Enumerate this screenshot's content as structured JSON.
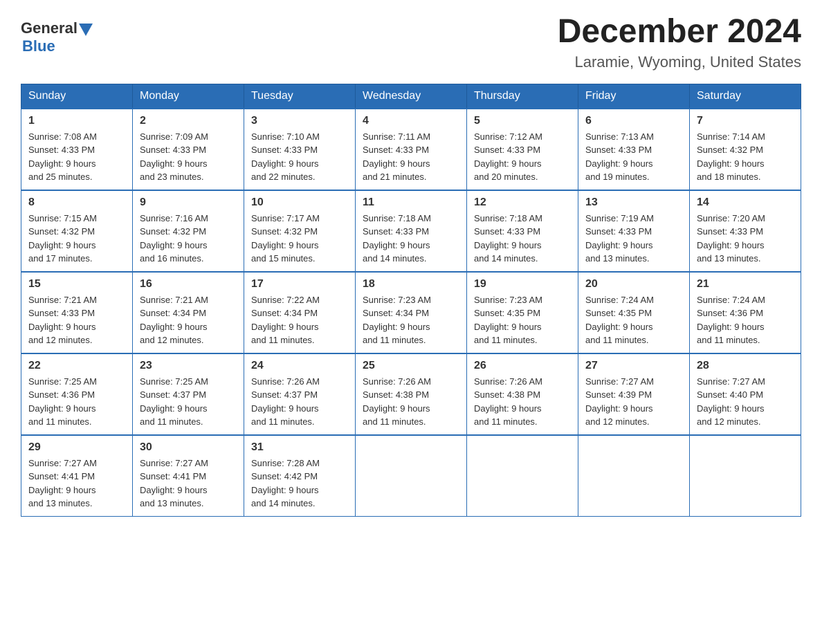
{
  "logo": {
    "general": "General",
    "blue": "Blue"
  },
  "header": {
    "month_year": "December 2024",
    "location": "Laramie, Wyoming, United States"
  },
  "weekdays": [
    "Sunday",
    "Monday",
    "Tuesday",
    "Wednesday",
    "Thursday",
    "Friday",
    "Saturday"
  ],
  "weeks": [
    [
      {
        "day": "1",
        "sunrise": "7:08 AM",
        "sunset": "4:33 PM",
        "daylight": "9 hours and 25 minutes."
      },
      {
        "day": "2",
        "sunrise": "7:09 AM",
        "sunset": "4:33 PM",
        "daylight": "9 hours and 23 minutes."
      },
      {
        "day": "3",
        "sunrise": "7:10 AM",
        "sunset": "4:33 PM",
        "daylight": "9 hours and 22 minutes."
      },
      {
        "day": "4",
        "sunrise": "7:11 AM",
        "sunset": "4:33 PM",
        "daylight": "9 hours and 21 minutes."
      },
      {
        "day": "5",
        "sunrise": "7:12 AM",
        "sunset": "4:33 PM",
        "daylight": "9 hours and 20 minutes."
      },
      {
        "day": "6",
        "sunrise": "7:13 AM",
        "sunset": "4:33 PM",
        "daylight": "9 hours and 19 minutes."
      },
      {
        "day": "7",
        "sunrise": "7:14 AM",
        "sunset": "4:32 PM",
        "daylight": "9 hours and 18 minutes."
      }
    ],
    [
      {
        "day": "8",
        "sunrise": "7:15 AM",
        "sunset": "4:32 PM",
        "daylight": "9 hours and 17 minutes."
      },
      {
        "day": "9",
        "sunrise": "7:16 AM",
        "sunset": "4:32 PM",
        "daylight": "9 hours and 16 minutes."
      },
      {
        "day": "10",
        "sunrise": "7:17 AM",
        "sunset": "4:32 PM",
        "daylight": "9 hours and 15 minutes."
      },
      {
        "day": "11",
        "sunrise": "7:18 AM",
        "sunset": "4:33 PM",
        "daylight": "9 hours and 14 minutes."
      },
      {
        "day": "12",
        "sunrise": "7:18 AM",
        "sunset": "4:33 PM",
        "daylight": "9 hours and 14 minutes."
      },
      {
        "day": "13",
        "sunrise": "7:19 AM",
        "sunset": "4:33 PM",
        "daylight": "9 hours and 13 minutes."
      },
      {
        "day": "14",
        "sunrise": "7:20 AM",
        "sunset": "4:33 PM",
        "daylight": "9 hours and 13 minutes."
      }
    ],
    [
      {
        "day": "15",
        "sunrise": "7:21 AM",
        "sunset": "4:33 PM",
        "daylight": "9 hours and 12 minutes."
      },
      {
        "day": "16",
        "sunrise": "7:21 AM",
        "sunset": "4:34 PM",
        "daylight": "9 hours and 12 minutes."
      },
      {
        "day": "17",
        "sunrise": "7:22 AM",
        "sunset": "4:34 PM",
        "daylight": "9 hours and 11 minutes."
      },
      {
        "day": "18",
        "sunrise": "7:23 AM",
        "sunset": "4:34 PM",
        "daylight": "9 hours and 11 minutes."
      },
      {
        "day": "19",
        "sunrise": "7:23 AM",
        "sunset": "4:35 PM",
        "daylight": "9 hours and 11 minutes."
      },
      {
        "day": "20",
        "sunrise": "7:24 AM",
        "sunset": "4:35 PM",
        "daylight": "9 hours and 11 minutes."
      },
      {
        "day": "21",
        "sunrise": "7:24 AM",
        "sunset": "4:36 PM",
        "daylight": "9 hours and 11 minutes."
      }
    ],
    [
      {
        "day": "22",
        "sunrise": "7:25 AM",
        "sunset": "4:36 PM",
        "daylight": "9 hours and 11 minutes."
      },
      {
        "day": "23",
        "sunrise": "7:25 AM",
        "sunset": "4:37 PM",
        "daylight": "9 hours and 11 minutes."
      },
      {
        "day": "24",
        "sunrise": "7:26 AM",
        "sunset": "4:37 PM",
        "daylight": "9 hours and 11 minutes."
      },
      {
        "day": "25",
        "sunrise": "7:26 AM",
        "sunset": "4:38 PM",
        "daylight": "9 hours and 11 minutes."
      },
      {
        "day": "26",
        "sunrise": "7:26 AM",
        "sunset": "4:38 PM",
        "daylight": "9 hours and 11 minutes."
      },
      {
        "day": "27",
        "sunrise": "7:27 AM",
        "sunset": "4:39 PM",
        "daylight": "9 hours and 12 minutes."
      },
      {
        "day": "28",
        "sunrise": "7:27 AM",
        "sunset": "4:40 PM",
        "daylight": "9 hours and 12 minutes."
      }
    ],
    [
      {
        "day": "29",
        "sunrise": "7:27 AM",
        "sunset": "4:41 PM",
        "daylight": "9 hours and 13 minutes."
      },
      {
        "day": "30",
        "sunrise": "7:27 AM",
        "sunset": "4:41 PM",
        "daylight": "9 hours and 13 minutes."
      },
      {
        "day": "31",
        "sunrise": "7:28 AM",
        "sunset": "4:42 PM",
        "daylight": "9 hours and 14 minutes."
      },
      null,
      null,
      null,
      null
    ]
  ],
  "labels": {
    "sunrise": "Sunrise:",
    "sunset": "Sunset:",
    "daylight": "Daylight:"
  }
}
